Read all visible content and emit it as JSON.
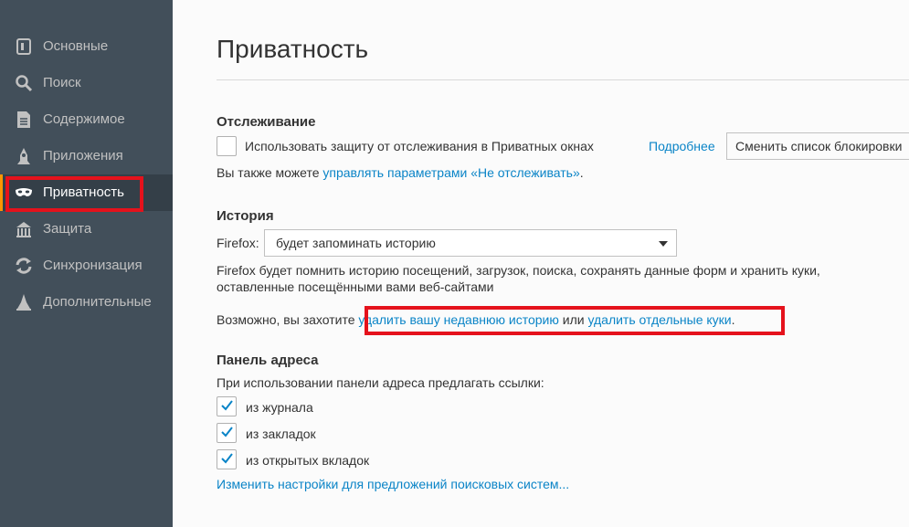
{
  "sidebar": {
    "items": [
      {
        "label": "Основные",
        "icon": "general-icon"
      },
      {
        "label": "Поиск",
        "icon": "search-icon"
      },
      {
        "label": "Содержимое",
        "icon": "content-icon"
      },
      {
        "label": "Приложения",
        "icon": "applications-icon"
      },
      {
        "label": "Приватность",
        "icon": "privacy-mask-icon",
        "selected": true
      },
      {
        "label": "Защита",
        "icon": "security-icon"
      },
      {
        "label": "Синхронизация",
        "icon": "sync-icon"
      },
      {
        "label": "Дополнительные",
        "icon": "advanced-icon"
      }
    ]
  },
  "page": {
    "title": "Приватность"
  },
  "tracking": {
    "title": "Отслеживание",
    "checkbox_label": "Использовать защиту от отслеживания в Приватных окнах",
    "checked": false,
    "learn_more": "Подробнее",
    "change_blocklist": "Сменить список блокировки",
    "dnt_prefix": "Вы также можете ",
    "dnt_link": "управлять параметрами «Не отслеживать»",
    "dnt_suffix": "."
  },
  "history": {
    "title": "История",
    "firefox_label": "Firefox:",
    "mode_value": "будет запоминать историю",
    "description_line1": "Firefox будет помнить историю посещений, загрузок, поиска, сохранять данные форм и хранить куки,",
    "description_line2": "оставленные посещёнными вами веб-сайтами",
    "maybe_prefix": "Возможно, вы захотите ",
    "clear_recent_link": "удалить вашу недавнюю историю",
    "or_text": " или ",
    "remove_cookies_link": "удалить отдельные куки",
    "maybe_suffix": "."
  },
  "address_bar": {
    "title": "Панель адреса",
    "subtitle": "При использовании панели адреса предлагать ссылки:",
    "options": [
      {
        "label": "из журнала",
        "checked": true
      },
      {
        "label": "из закладок",
        "checked": true
      },
      {
        "label": "из открытых вкладок",
        "checked": true
      }
    ],
    "search_suggest_link": "Изменить настройки для предложений поисковых систем..."
  },
  "colors": {
    "sidebar_bg": "#424f5a",
    "sidebar_selected_bg": "#343f48",
    "accent": "#ff9500",
    "link": "#0a84c7",
    "highlight_red": "#e5121c"
  }
}
